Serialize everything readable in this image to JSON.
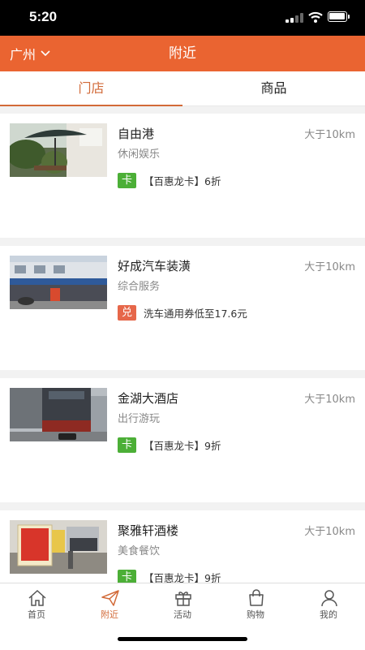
{
  "status_bar": {
    "time": "5:20"
  },
  "header": {
    "city": "广州",
    "title": "附近"
  },
  "tabs": [
    {
      "label": "门店",
      "active": true
    },
    {
      "label": "商品",
      "active": false
    }
  ],
  "stores": [
    {
      "name": "自由港",
      "category": "休闲娱乐",
      "distance": "大于10km",
      "badge": "卡",
      "badge_type": "card",
      "promo": "【百惠龙卡】6折"
    },
    {
      "name": "好成汽车装潢",
      "category": "综合服务",
      "distance": "大于10km",
      "badge": "兑",
      "badge_type": "coupon",
      "promo": "洗车通用券低至17.6元"
    },
    {
      "name": "金湖大酒店",
      "category": "出行游玩",
      "distance": "大于10km",
      "badge": "卡",
      "badge_type": "card",
      "promo": "【百惠龙卡】9折"
    },
    {
      "name": "聚雅轩酒楼",
      "category": "美食餐饮",
      "distance": "大于10km",
      "badge": "卡",
      "badge_type": "card",
      "promo": "【百惠龙卡】9折"
    }
  ],
  "bottom_nav": [
    {
      "label": "首页",
      "icon": "home-icon",
      "active": false
    },
    {
      "label": "附近",
      "icon": "paper-plane-icon",
      "active": true
    },
    {
      "label": "活动",
      "icon": "gift-icon",
      "active": false
    },
    {
      "label": "购物",
      "icon": "shopping-bag-icon",
      "active": false
    },
    {
      "label": "我的",
      "icon": "user-icon",
      "active": false
    }
  ],
  "colors": {
    "brand": "#ea6431",
    "tab_active": "#d26a38",
    "card_badge": "#4caf37",
    "coupon_badge": "#e6674a"
  }
}
